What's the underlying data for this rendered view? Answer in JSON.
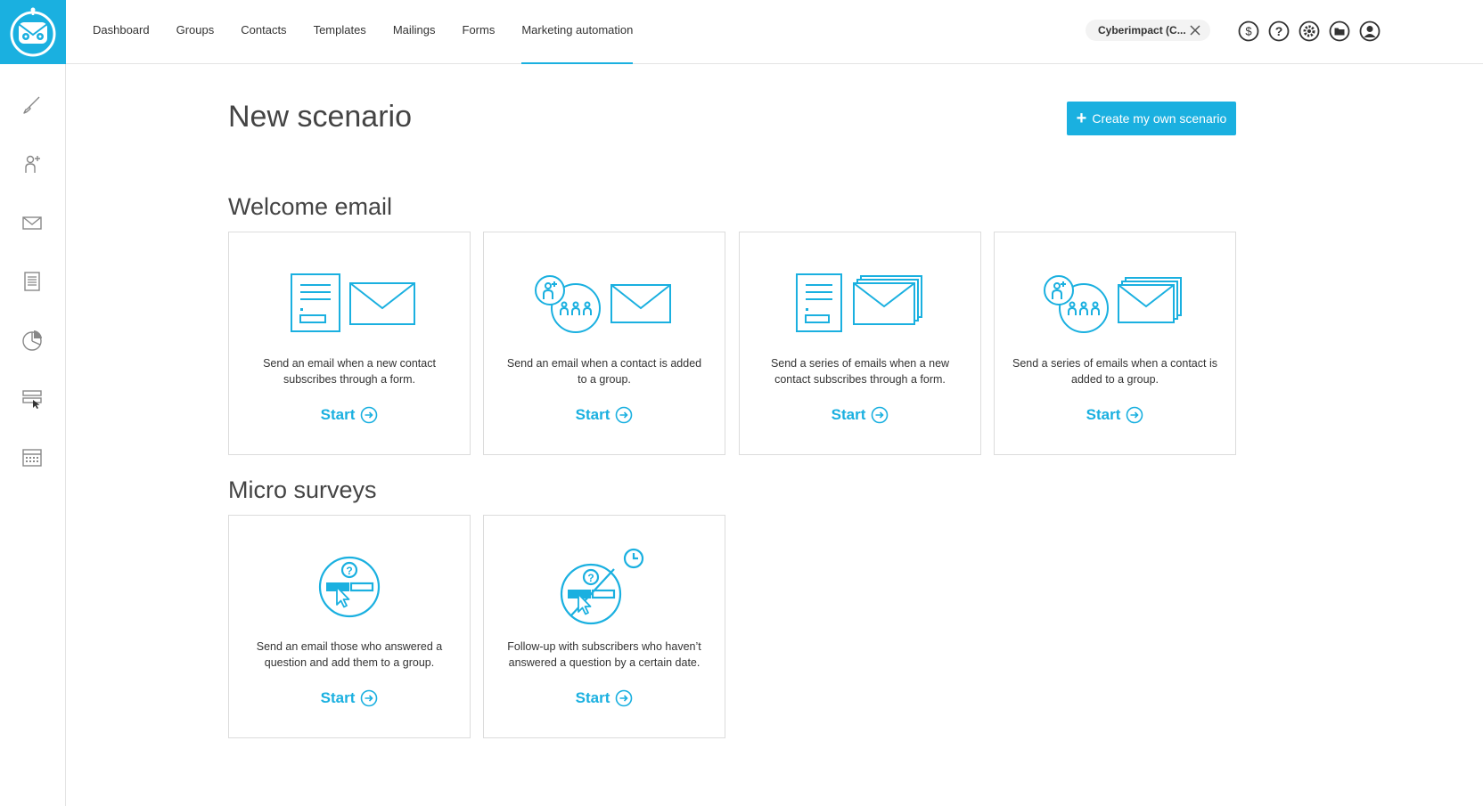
{
  "nav": {
    "items": [
      {
        "label": "Dashboard"
      },
      {
        "label": "Groups"
      },
      {
        "label": "Contacts"
      },
      {
        "label": "Templates"
      },
      {
        "label": "Mailings"
      },
      {
        "label": "Forms"
      },
      {
        "label": "Marketing automation",
        "active": true
      }
    ]
  },
  "account": {
    "name": "Cyberimpact (C..."
  },
  "top_icons": [
    "dollar-icon",
    "help-icon",
    "settings-icon",
    "folder-icon",
    "user-icon"
  ],
  "sidebar": {
    "icons": [
      "brush-icon",
      "add-contact-icon",
      "envelope-icon",
      "form-icon",
      "pie-chart-icon",
      "field-cursor-icon",
      "calendar-icon"
    ]
  },
  "page": {
    "title": "New scenario",
    "create_button": "Create my own scenario"
  },
  "sections": {
    "welcome": {
      "title": "Welcome email",
      "cards": [
        {
          "desc": "Send an email when a new contact subscribes through a form.",
          "start": "Start"
        },
        {
          "desc": "Send an email when a contact is added to a group.",
          "start": "Start"
        },
        {
          "desc": "Send a series of emails when a new contact subscribes through a form.",
          "start": "Start"
        },
        {
          "desc": "Send a series of emails when a contact is added to a group.",
          "start": "Start"
        }
      ]
    },
    "surveys": {
      "title": "Micro surveys",
      "cards": [
        {
          "desc": "Send an email those who answered a question and add them to a group.",
          "start": "Start"
        },
        {
          "desc": "Follow-up with subscribers who haven’t answered a question by a certain date.",
          "start": "Start"
        }
      ]
    }
  },
  "colors": {
    "accent": "#1ab0e0",
    "icon_gray": "#888888",
    "border": "#dcdcdc"
  }
}
